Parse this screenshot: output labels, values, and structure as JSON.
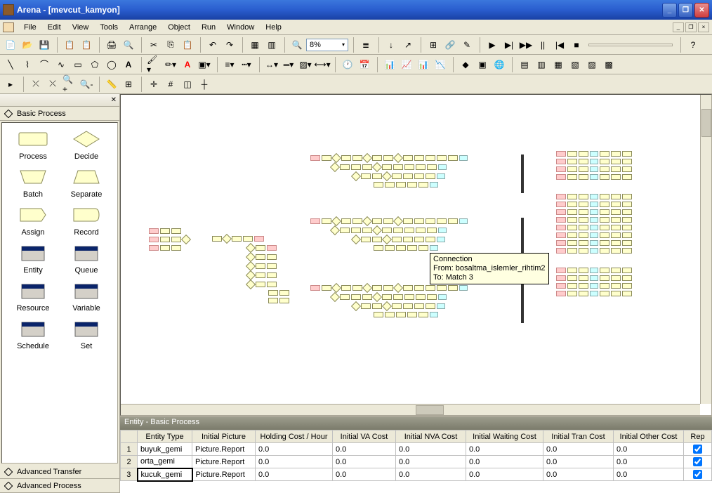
{
  "titlebar": {
    "app": "Arena",
    "doc": "[mevcut_kamyon]"
  },
  "menu": {
    "file": "File",
    "edit": "Edit",
    "view": "View",
    "tools": "Tools",
    "arrange": "Arrange",
    "object": "Object",
    "run": "Run",
    "window": "Window",
    "help": "Help"
  },
  "toolbar": {
    "zoom": "8%"
  },
  "panels": {
    "basic_process": "Basic Process",
    "advanced_transfer": "Advanced Transfer",
    "advanced_process": "Advanced Process"
  },
  "modules": {
    "process": "Process",
    "decide": "Decide",
    "batch": "Batch",
    "separate": "Separate",
    "assign": "Assign",
    "record": "Record",
    "entity": "Entity",
    "queue": "Queue",
    "resource": "Resource",
    "variable": "Variable",
    "schedule": "Schedule",
    "set": "Set"
  },
  "tooltip": {
    "title": "Connection",
    "from": "From: bosaltma_islemler_rihtim2",
    "to": "To: Match 3"
  },
  "spreadsheet": {
    "title": "Entity - Basic Process",
    "headers": {
      "entity_type": "Entity Type",
      "initial_picture": "Initial Picture",
      "holding_cost": "Holding Cost / Hour",
      "va_cost": "Initial VA Cost",
      "nva_cost": "Initial NVA Cost",
      "waiting_cost": "Initial Waiting Cost",
      "tran_cost": "Initial Tran Cost",
      "other_cost": "Initial Other Cost",
      "report": "Rep"
    },
    "rows": [
      {
        "n": "1",
        "entity_type": "buyuk_gemi",
        "initial_picture": "Picture.Report",
        "holding_cost": "0.0",
        "va_cost": "0.0",
        "nva_cost": "0.0",
        "waiting_cost": "0.0",
        "tran_cost": "0.0",
        "other_cost": "0.0"
      },
      {
        "n": "2",
        "entity_type": "orta_gemi",
        "initial_picture": "Picture.Report",
        "holding_cost": "0.0",
        "va_cost": "0.0",
        "nva_cost": "0.0",
        "waiting_cost": "0.0",
        "tran_cost": "0.0",
        "other_cost": "0.0"
      },
      {
        "n": "3",
        "entity_type": "kucuk_gemi",
        "initial_picture": "Picture.Report",
        "holding_cost": "0.0",
        "va_cost": "0.0",
        "nva_cost": "0.0",
        "waiting_cost": "0.0",
        "tran_cost": "0.0",
        "other_cost": "0.0"
      }
    ]
  }
}
